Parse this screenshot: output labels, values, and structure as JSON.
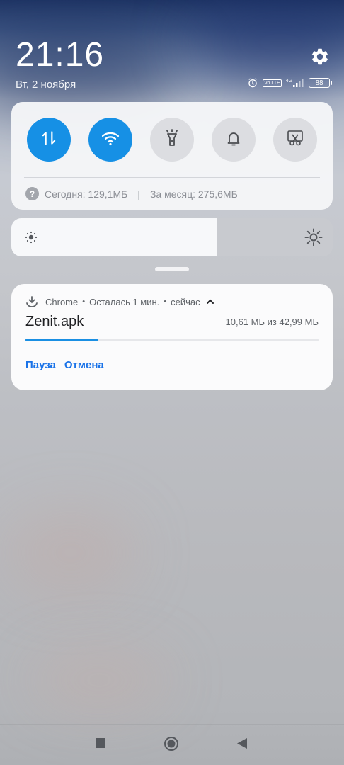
{
  "header": {
    "time": "21:16",
    "date": "Вт, 2 ноября",
    "status": {
      "volte": "Vo LTE",
      "network": "4G",
      "battery": "88"
    }
  },
  "quick_settings": {
    "toggles": [
      {
        "name": "mobile-data",
        "state": "on",
        "icon": "updown-arrows-icon"
      },
      {
        "name": "wifi",
        "state": "on",
        "icon": "wifi-icon"
      },
      {
        "name": "flashlight",
        "state": "off",
        "icon": "flashlight-icon"
      },
      {
        "name": "sound",
        "state": "off",
        "icon": "bell-icon"
      },
      {
        "name": "screenshot",
        "state": "off",
        "icon": "scissors-icon"
      }
    ],
    "usage": {
      "help": "?",
      "today": "Сегодня: 129,1МБ",
      "separator": "|",
      "month": "За месяц: 275,6МБ"
    }
  },
  "brightness": {
    "level_fraction": 0.64
  },
  "notification": {
    "app": "Chrome",
    "separator": "•",
    "remaining": "Осталась 1 мин.",
    "when": "сейчас",
    "filename": "Zenit.apk",
    "progress_text": "10,61 МБ из 42,99 МБ",
    "progress_fraction": 0.247,
    "actions": {
      "pause": "Пауза",
      "cancel": "Отмена"
    }
  },
  "colors": {
    "accent": "#1690e5",
    "action_text": "#1a73e8"
  }
}
